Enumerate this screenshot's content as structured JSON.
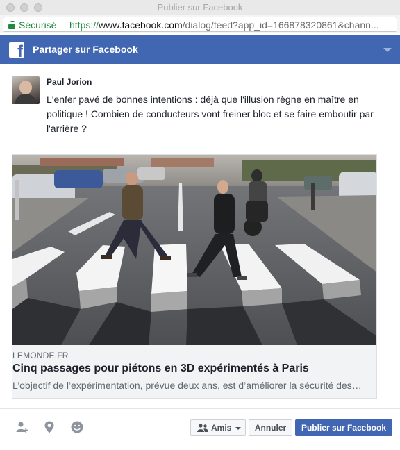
{
  "window": {
    "title": "Publier sur Facebook"
  },
  "address_bar": {
    "security_label": "Sécurisé",
    "url_scheme": "https://",
    "url_host": "www.facebook.com",
    "url_path": "/dialog/feed?app_id=166878320861&chann..."
  },
  "dialog": {
    "header_title": "Partager sur Facebook"
  },
  "composer": {
    "author_name": "Paul Jorion",
    "status_text": "L'enfer pavé de bonnes intentions : déjà que l'illusion règne en maître en politique ! Combien de conducteurs vont freiner bloc et se faire emboutir par l'arrière ?"
  },
  "link_preview": {
    "domain": "LEMONDE.FR",
    "title": "Cinq passages pour piétons en 3D expérimentés à Paris",
    "description": "L’objectif de l’expérimentation, prévue deux ans, est d’améliorer la sécurité des…"
  },
  "footer": {
    "audience_label": "Amis",
    "cancel_label": "Annuler",
    "publish_label": "Publier sur Facebook"
  },
  "colors": {
    "facebook_blue": "#4267b2",
    "secure_green": "#1e8a3e",
    "card_background": "#f2f3f5"
  },
  "icons": [
    "lock-icon",
    "facebook-logo-icon",
    "tag-friends-icon",
    "location-pin-icon",
    "emoji-icon",
    "friends-icon",
    "chevron-down-icon"
  ]
}
